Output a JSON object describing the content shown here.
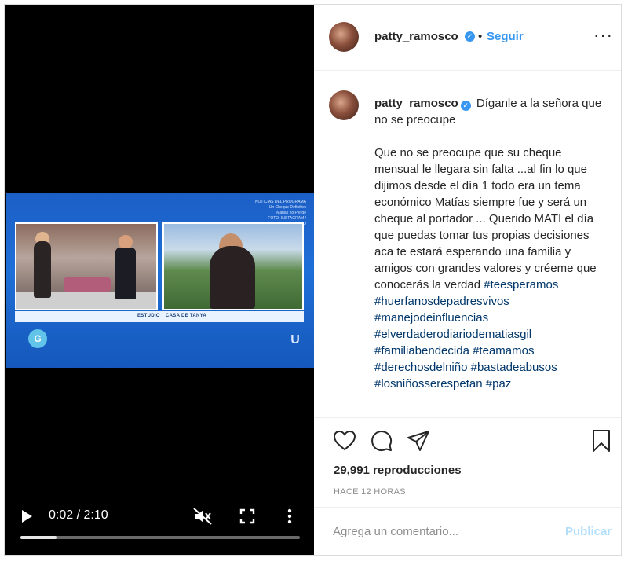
{
  "video": {
    "thumbnail": {
      "caption_lines": [
        "NOTICIAS DEL PROGRAMA",
        "Un Cheque Definitivo",
        "Matías no Pierde",
        "FOTO: INSTAGRAM / @PATTY_RAMOSCO"
      ],
      "label_left": "ESTUDIO",
      "label_right": "CASA DE TANYA"
    },
    "controls": {
      "time": "0:02 / 2:10",
      "progress": 0.13
    }
  },
  "post": {
    "username": "patty_ramosco",
    "separator": "•",
    "follow_label": "Seguir",
    "options_icon": "more-horizontal-icon",
    "caption_first": "Díganle a la señora que no se preocupe",
    "caption_body": "Que no se preocupe que su cheque mensual le llegara sin falta ...al fin lo que dijimos desde el día 1 todo era un tema económico Matías siempre fue y será un cheque al portador ... Querido MATI el día que puedas tomar tus propias decisiones aca te estará esperando una familia y amigos con grandes valores y créeme que conocerás la verdad",
    "hashtags": [
      "#teesperamos",
      "#huerfanosdepadresvivos",
      "#manejodeinfluencias",
      "#elverdaderodiariodematiasgil",
      "#familiabendecida",
      "#teamamos",
      "#derechosdelniño",
      "#bastadeabusos",
      "#losniñosserespetan",
      "#paz"
    ],
    "views": "29,991 reproducciones",
    "time_ago": "HACE 12 HORAS",
    "comment_placeholder": "Agrega un comentario...",
    "publish_label": "Publicar"
  },
  "colors": {
    "accent": "#3897f0",
    "hashtag": "#00376b",
    "publish_disabled": "#b2dffc"
  }
}
